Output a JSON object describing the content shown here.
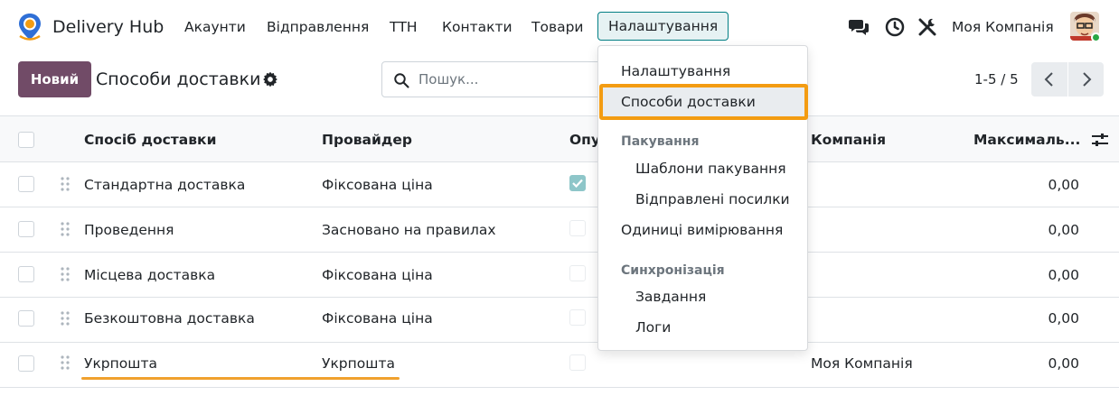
{
  "navbar": {
    "app_name": "Delivery Hub",
    "menu": [
      "Акаунти",
      "Відправлення",
      "ТТН",
      "Контакти",
      "Товари",
      "Налаштування"
    ],
    "company": "Моя Компанія",
    "icons": [
      "chat-icon",
      "clock-icon",
      "tools-icon"
    ]
  },
  "control": {
    "new_label": "Новий",
    "title": "Способи доставки",
    "search_placeholder": "Пошук...",
    "pager": "1-5 / 5"
  },
  "table": {
    "columns": [
      "Спосіб доставки",
      "Провайдер",
      "Опу",
      "Компанія",
      "Максималь..."
    ],
    "rows": [
      {
        "name": "Стандартна доставка",
        "provider": "Фіксована ціна",
        "published": true,
        "company": "",
        "max": "0,00"
      },
      {
        "name": "Проведення",
        "provider": "Засновано на правилах",
        "published": false,
        "company": "",
        "max": "0,00"
      },
      {
        "name": "Місцева доставка",
        "provider": "Фіксована ціна",
        "published": false,
        "company": "",
        "max": "0,00"
      },
      {
        "name": "Безкоштовна доставка",
        "provider": "Фіксована ціна",
        "published": false,
        "company": "",
        "max": "0,00"
      },
      {
        "name": "Укрпошта",
        "provider": "Укрпошта",
        "published": false,
        "company": "Моя Компанія",
        "max": "0,00"
      }
    ]
  },
  "dropdown": {
    "item_settings": "Налаштування",
    "item_delivery_methods": "Способи доставки",
    "header_packaging": "Пакування",
    "item_package_templates": "Шаблони пакування",
    "item_sent_packages": "Відправлені посилки",
    "item_uom": "Одиниці вимірювання",
    "header_sync": "Синхронізація",
    "item_tasks": "Завдання",
    "item_logs": "Логи"
  },
  "colors": {
    "brand": "#714b67",
    "accent": "#017e84",
    "highlight": "#f39c12"
  }
}
